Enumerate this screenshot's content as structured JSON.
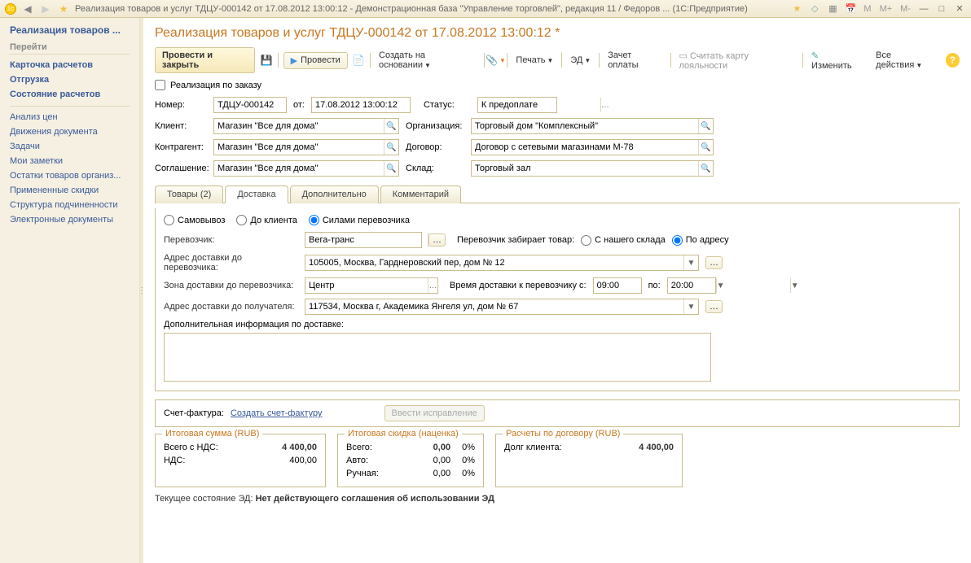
{
  "titlebar": {
    "text": "Реализация товаров и услуг ТДЦУ-000142 от 17.08.2012 13:00:12 - Демонстрационная база \"Управление торговлей\", редакция 11 / Федоров ...  (1С:Предприятие)"
  },
  "sidebar": {
    "header": "Реализация товаров ...",
    "section1": "Перейти",
    "section1_items": [
      "Карточка расчетов",
      "Отгрузка",
      "Состояние расчетов"
    ],
    "section2_items": [
      "Анализ цен",
      "Движения документа",
      "Задачи",
      "Мои заметки",
      "Остатки товаров организ...",
      "Примененные скидки",
      "Структура подчиненности",
      "Электронные документы"
    ]
  },
  "doc": {
    "title": "Реализация товаров и услуг ТДЦУ-000142 от 17.08.2012 13:00:12 *"
  },
  "toolbar": {
    "post_close": "Провести и закрыть",
    "post": "Провести",
    "create_based": "Создать на основании",
    "print": "Печать",
    "ed": "ЭД",
    "offset": "Зачет оплаты",
    "loyalty": "Считать карту лояльности",
    "edit": "Изменить",
    "all_actions": "Все действия"
  },
  "checkbox": {
    "by_order": "Реализация по заказу"
  },
  "form": {
    "number_label": "Номер:",
    "number": "ТДЦУ-000142",
    "from": "от:",
    "date": "17.08.2012 13:00:12",
    "status_label": "Статус:",
    "status": "К предоплате",
    "client_label": "Клиент:",
    "client": "Магазин \"Все для дома\"",
    "org_label": "Организация:",
    "org": "Торговый дом \"Комплексный\"",
    "counterparty_label": "Контрагент:",
    "counterparty": "Магазин \"Все для дома\"",
    "contract_label": "Договор:",
    "contract": "Договор с сетевыми магазинами М-78",
    "agreement_label": "Соглашение:",
    "agreement": "Магазин \"Все для дома\"",
    "warehouse_label": "Склад:",
    "warehouse": "Торговый зал"
  },
  "tabs": [
    "Товары (2)",
    "Доставка",
    "Дополнительно",
    "Комментарий"
  ],
  "delivery": {
    "radio1": "Самовывоз",
    "radio2": "До клиента",
    "radio3": "Силами перевозчика",
    "carrier_label": "Перевозчик:",
    "carrier": "Вега-транс",
    "pickup_label": "Перевозчик забирает товар:",
    "pickup_opt1": "С нашего склада",
    "pickup_opt2": "По адресу",
    "addr_to_carrier_label": "Адрес доставки до перевозчика:",
    "addr_to_carrier": "105005, Москва, Гарднеровский пер, дом № 12",
    "zone_label": "Зона доставки до перевозчика:",
    "zone": "Центр",
    "time_label": "Время доставки к перевозчику с:",
    "time_from": "09:00",
    "time_to_label": "по:",
    "time_to": "20:00",
    "addr_to_recipient_label": "Адрес доставки до получателя:",
    "addr_to_recipient": "117534, Москва г, Академика Янгеля ул, дом № 67",
    "extra_info_label": "Дополнительная информация по доставке:"
  },
  "invoice": {
    "label": "Счет-фактура:",
    "create_link": "Создать счет-фактуру",
    "correction_btn": "Ввести исправление"
  },
  "totals": {
    "box1_title": "Итоговая сумма (RUB)",
    "total_vat_label": "Всего с НДС:",
    "total_vat": "4 400,00",
    "vat_label": "НДС:",
    "vat": "400,00",
    "box2_title": "Итоговая скидка (наценка)",
    "disc_total_label": "Всего:",
    "disc_total": "0,00",
    "disc_total_pct": "0%",
    "disc_auto_label": "Авто:",
    "disc_auto": "0,00",
    "disc_auto_pct": "0%",
    "disc_manual_label": "Ручная:",
    "disc_manual": "0,00",
    "disc_manual_pct": "0%",
    "box3_title": "Расчеты по договору (RUB)",
    "debt_label": "Долг клиента:",
    "debt": "4 400,00"
  },
  "ed_status": {
    "label": "Текущее состояние ЭД:",
    "value": "Нет действующего соглашения об использовании ЭД"
  }
}
